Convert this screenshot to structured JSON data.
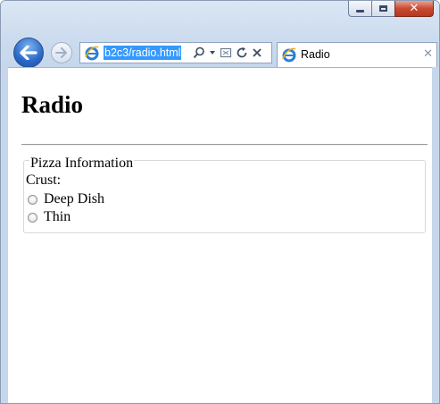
{
  "browser": {
    "address_url": "b2c3/radio.html",
    "tab_title": "Radio",
    "caption": {
      "minimize": "minimize-icon",
      "maximize": "maximize-icon",
      "close": "close-icon"
    },
    "accent_color": "#2a67c6",
    "close_color": "#c94a33"
  },
  "page": {
    "title": "Radio",
    "fieldset": {
      "legend": "Pizza Information",
      "group_label": "Crust:",
      "options": [
        {
          "label": "Deep Dish",
          "checked": false
        },
        {
          "label": "Thin",
          "checked": false
        }
      ]
    }
  }
}
